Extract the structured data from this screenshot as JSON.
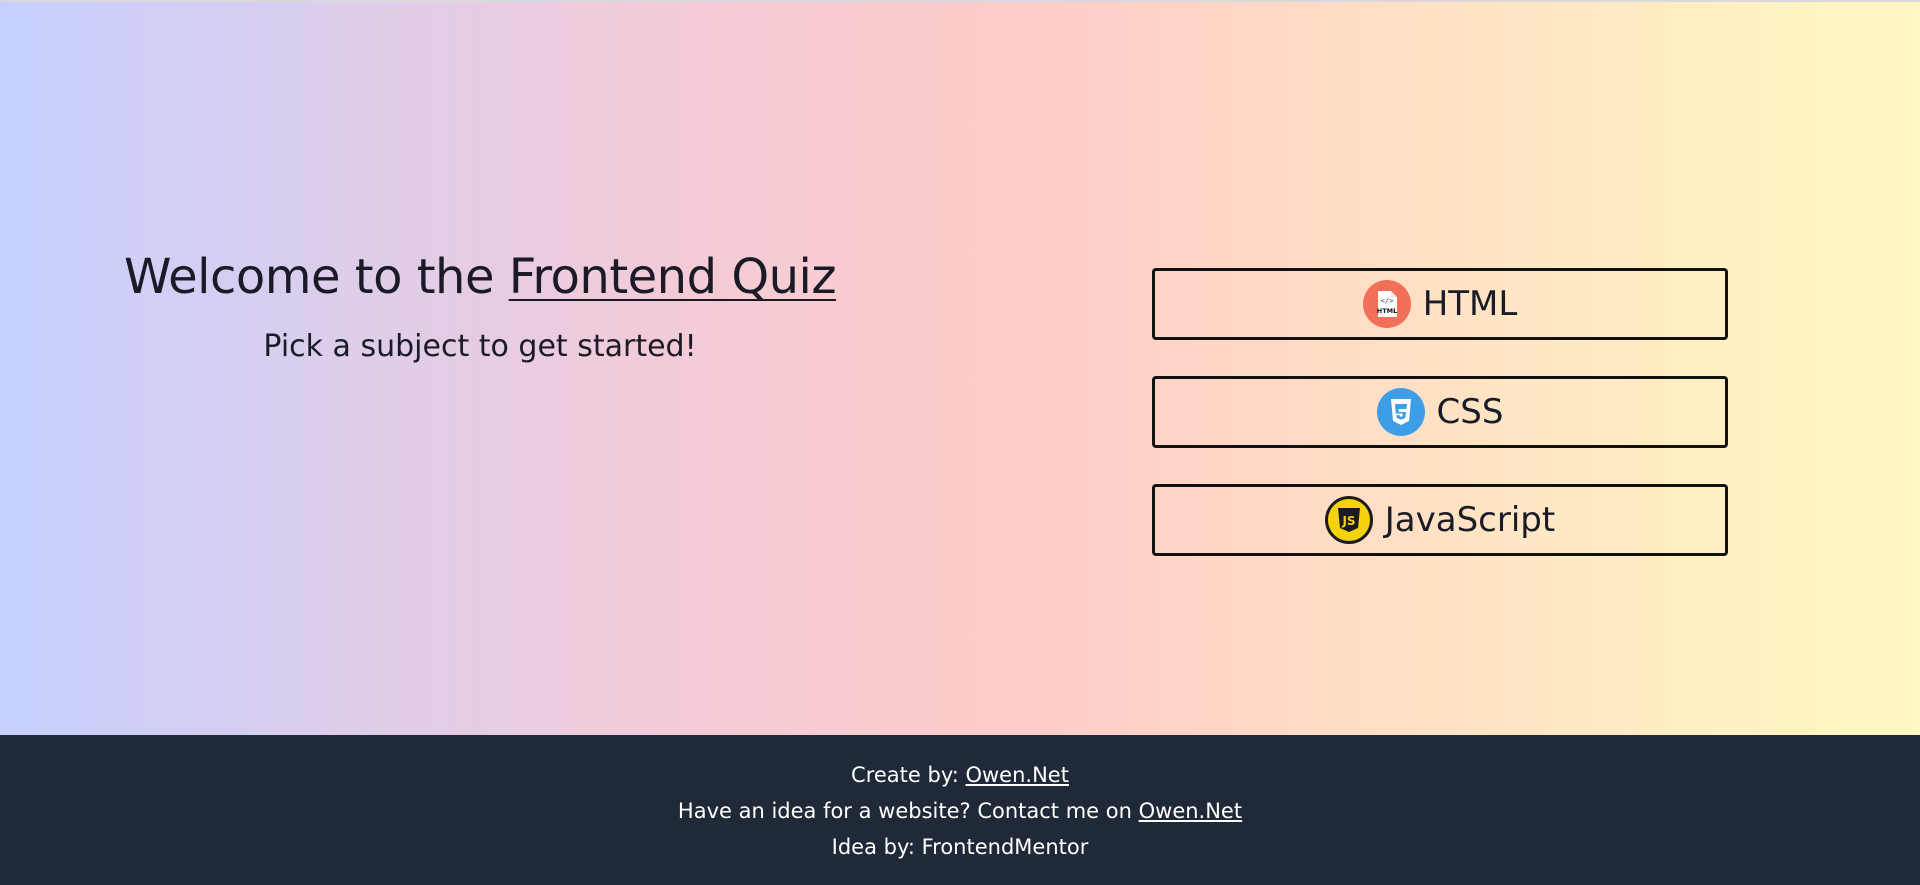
{
  "hero": {
    "title_prefix": "Welcome to the ",
    "title_link": "Frontend Quiz",
    "subtitle": "Pick a subject to get started!"
  },
  "subjects": [
    {
      "label": "HTML",
      "icon": "html-icon",
      "color": "#f2705a"
    },
    {
      "label": "CSS",
      "icon": "css-icon",
      "color": "#3d9ee6"
    },
    {
      "label": "JavaScript",
      "icon": "javascript-icon",
      "color": "#f5d20a"
    }
  ],
  "footer": {
    "created_prefix": "Create by: ",
    "created_link": "Owen.Net",
    "contact_prefix": "Have an idea for a website? Contact me on ",
    "contact_link": "Owen.Net",
    "idea": "Idea by: FrontendMentor"
  },
  "colors": {
    "footer_bg": "#1f2937",
    "gradient_start": "#c6d0ff",
    "gradient_end": "#fff8c2"
  }
}
